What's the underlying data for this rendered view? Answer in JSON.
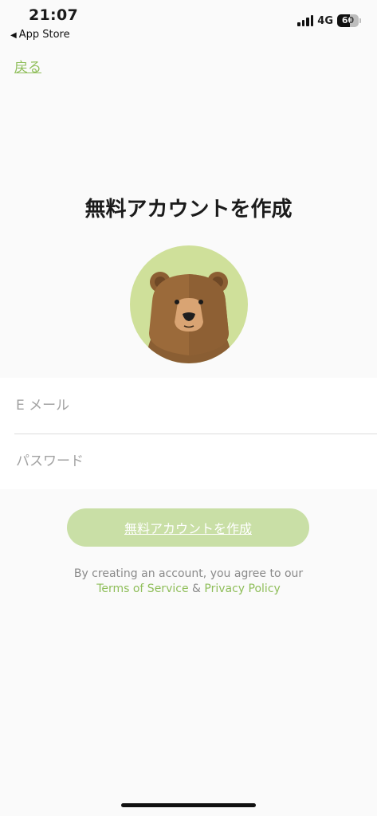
{
  "status_bar": {
    "time": "21:07",
    "back_app_label": "App Store",
    "network": "4G",
    "battery_percent": 60,
    "battery_label": "60",
    "signal_bars": 4
  },
  "nav": {
    "back_label": "戻る"
  },
  "header": {
    "title": "無料アカウントを作成"
  },
  "avatar": {
    "icon": "bear-mascot-icon",
    "background_color": "#cfe09a"
  },
  "form": {
    "email": {
      "placeholder": "E メール",
      "value": ""
    },
    "password": {
      "placeholder": "パスワード",
      "value": ""
    }
  },
  "actions": {
    "create_account_label": "無料アカウントを作成"
  },
  "legal": {
    "line1": "By creating an account, you agree to our",
    "terms_label": "Terms of Service",
    "separator": " & ",
    "privacy_label": "Privacy Policy"
  },
  "colors": {
    "accent": "#8fbe5a",
    "button_bg": "#c9dfa6",
    "page_bg": "#fafafa"
  }
}
